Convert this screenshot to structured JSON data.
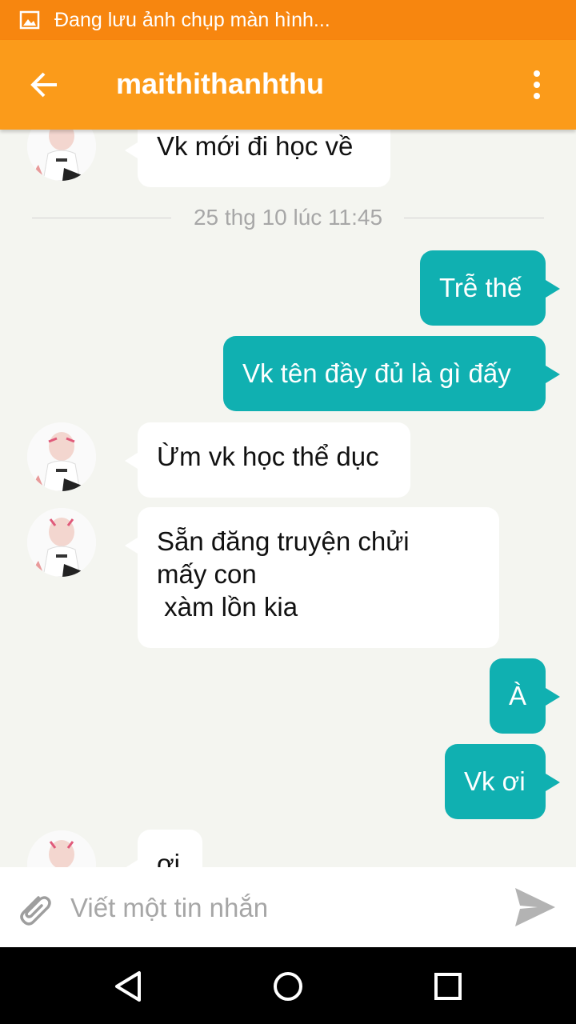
{
  "status_bar": {
    "icon": "image-icon",
    "text": "Đang lưu ảnh chụp màn hình..."
  },
  "header": {
    "title": "maithithanhthu",
    "back_icon": "arrow-back-icon",
    "menu_icon": "more-vert-icon"
  },
  "colors": {
    "status_bar": "#f7860f",
    "app_bar": "#fb9b1a",
    "outgoing_bubble": "#10b0b1",
    "incoming_bubble": "#ffffff",
    "chat_background": "#f4f5f0"
  },
  "messages": [
    {
      "direction": "in",
      "text": "Vk mới đi học về"
    },
    {
      "direction": "out",
      "text": "Trễ thế"
    },
    {
      "direction": "out",
      "text": "Vk tên đầy đủ là gì đấy"
    },
    {
      "direction": "in",
      "text": "Ừm vk học thể dục"
    },
    {
      "direction": "in",
      "lines": [
        "Sẵn đăng truyện chửi",
        "mấy con",
        " xàm lồn kia"
      ]
    },
    {
      "direction": "out",
      "text": "À"
    },
    {
      "direction": "out",
      "text": "Vk ơi"
    },
    {
      "direction": "in",
      "text": "ơi"
    }
  ],
  "timestamp": "25 thg 10 lúc 11:45",
  "composer": {
    "placeholder": "Viết một tin nhắn",
    "attach_icon": "paperclip-icon",
    "send_icon": "send-icon"
  },
  "nav_bar": {
    "back_icon": "triangle-back-icon",
    "home_icon": "circle-home-icon",
    "recents_icon": "square-recents-icon"
  }
}
